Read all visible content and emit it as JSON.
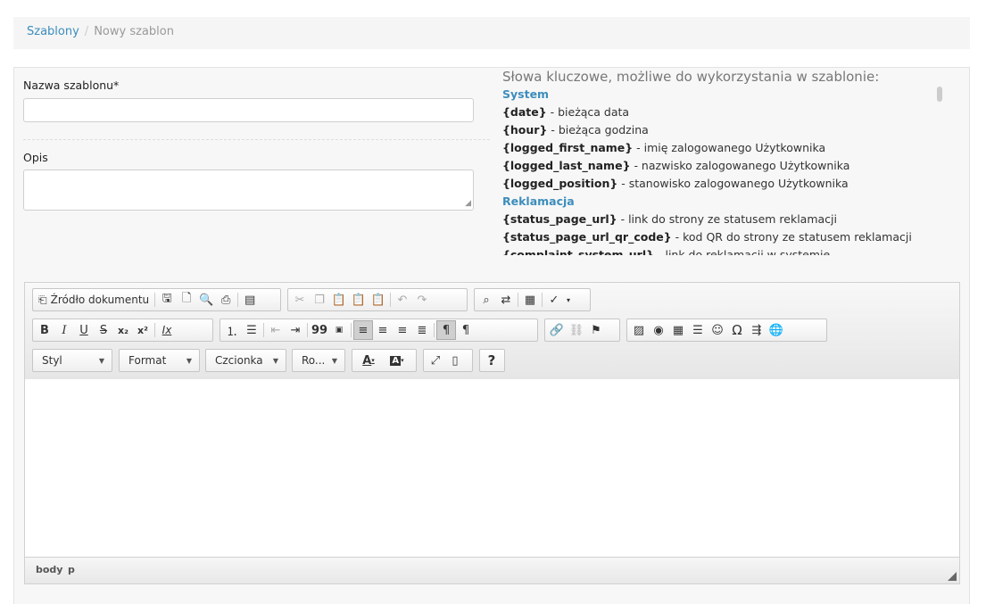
{
  "breadcrumb": {
    "parent": "Szablony",
    "separator": "/",
    "current": "Nowy szablon"
  },
  "form": {
    "name_label": "Nazwa szablonu*",
    "name_value": "",
    "desc_label": "Opis",
    "desc_value": ""
  },
  "keywords": {
    "title": "Słowa kluczowe, możliwe do wykorzystania w szablonie:",
    "groups": [
      {
        "name": "System",
        "items": [
          {
            "key": "{date}",
            "desc": " - bieżąca data"
          },
          {
            "key": "{hour}",
            "desc": " - bieżąca godzina"
          },
          {
            "key": "{logged_first_name}",
            "desc": " - imię zalogowanego Użytkownika"
          },
          {
            "key": "{logged_last_name}",
            "desc": " - nazwisko zalogowanego Użytkownika"
          },
          {
            "key": "{logged_position}",
            "desc": " - stanowisko zalogowanego Użytkownika"
          }
        ]
      },
      {
        "name": "Reklamacja",
        "items": [
          {
            "key": "{status_page_url}",
            "desc": " - link do strony ze statusem reklamacji"
          },
          {
            "key": "{status_page_url_qr_code}",
            "desc": " - kod QR do strony ze statusem reklamacji"
          },
          {
            "key": "{complaint_system_url}",
            "desc": " - link do reklamacji w systemie"
          }
        ]
      }
    ]
  },
  "editor": {
    "source_label": "Źródło dokumentu",
    "combos": {
      "style": "Styl",
      "format": "Format",
      "font": "Czcionka",
      "size": "Ro..."
    },
    "path": [
      "body",
      "p"
    ],
    "icons": {
      "bold": "B",
      "italic": "I",
      "underline": "U",
      "strike": "S",
      "subscript": "x₂",
      "superscript": "x²",
      "remove_format": "Ix",
      "blockquote": "99",
      "help": "?",
      "omega": "Ω",
      "text_color": "A",
      "bg_color": "A"
    }
  },
  "colors": {
    "link": "#3c8dbc",
    "panel_bg": "#f7f7f7",
    "toolbar_bg": "#e6e6e6"
  }
}
